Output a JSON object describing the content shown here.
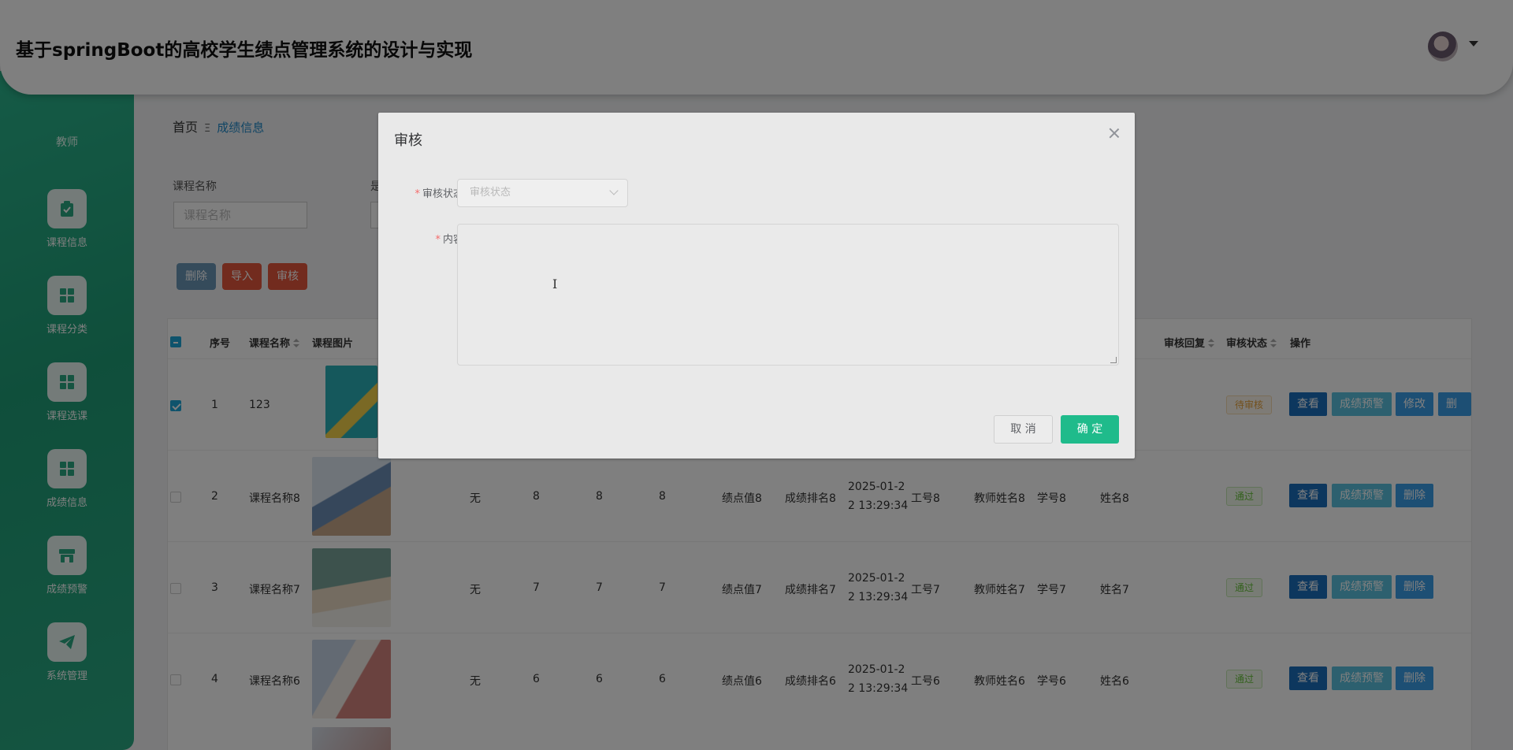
{
  "header": {
    "title": "基于springBoot的高校学生绩点管理系统的设计与实现"
  },
  "sidebar": {
    "role": "教师",
    "items": [
      {
        "label": "课程信息",
        "icon": "clipboard-check-icon"
      },
      {
        "label": "课程分类",
        "icon": "grid-icon"
      },
      {
        "label": "课程选课",
        "icon": "grid-icon"
      },
      {
        "label": "成绩信息",
        "icon": "grid-icon"
      },
      {
        "label": "成绩预警",
        "icon": "store-icon"
      },
      {
        "label": "系统管理",
        "icon": "paper-plane-icon"
      }
    ]
  },
  "breadcrumb": {
    "home": "首页",
    "separator": "Ξ",
    "current": "成绩信息"
  },
  "filters": {
    "course_label": "课程名称",
    "course_placeholder": "课程名称",
    "second_label": "是"
  },
  "toolbar": {
    "delete": "删除",
    "import": "导入",
    "audit": "审核"
  },
  "table": {
    "headers": {
      "index": "序号",
      "course_name": "课程名称",
      "course_image": "课程图片",
      "audit_reply": "审核回复",
      "audit_status": "审核状态",
      "actions": "操作"
    },
    "rows": [
      {
        "index": "1",
        "course_name": "123",
        "c1": "",
        "c2": "",
        "c3": "",
        "c4": "",
        "gpa": "",
        "rank": "",
        "time1": "",
        "time2": "",
        "teacher_no": "",
        "teacher_name": "",
        "student_no": "",
        "student_name": "",
        "status": "待审核",
        "checked": true
      },
      {
        "index": "2",
        "course_name": "课程名称8",
        "c1": "无",
        "c2": "8",
        "c3": "8",
        "c4": "8",
        "gpa": "绩点值8",
        "rank": "成绩排名8",
        "time1": "2025-01-2",
        "time2": "2 13:29:34",
        "teacher_no": "工号8",
        "teacher_name": "教师姓名8",
        "student_no": "学号8",
        "student_name": "姓名8",
        "status": "通过",
        "checked": false
      },
      {
        "index": "3",
        "course_name": "课程名称7",
        "c1": "无",
        "c2": "7",
        "c3": "7",
        "c4": "7",
        "gpa": "绩点值7",
        "rank": "成绩排名7",
        "time1": "2025-01-2",
        "time2": "2 13:29:34",
        "teacher_no": "工号7",
        "teacher_name": "教师姓名7",
        "student_no": "学号7",
        "student_name": "姓名7",
        "status": "通过",
        "checked": false
      },
      {
        "index": "4",
        "course_name": "课程名称6",
        "c1": "无",
        "c2": "6",
        "c3": "6",
        "c4": "6",
        "gpa": "绩点值6",
        "rank": "成绩排名6",
        "time1": "2025-01-2",
        "time2": "2 13:29:34",
        "teacher_no": "工号6",
        "teacher_name": "教师姓名6",
        "student_no": "学号6",
        "student_name": "姓名6",
        "status": "通过",
        "checked": false
      }
    ],
    "actions": {
      "view": "查看",
      "warning": "成绩预警",
      "edit": "修改",
      "delete": "删除"
    }
  },
  "dialog": {
    "title": "审核",
    "status_label": "审核状态",
    "status_placeholder": "审核状态",
    "content_label": "内容",
    "content_value": "",
    "cancel": "取 消",
    "confirm": "确 定"
  },
  "colors": {
    "accent": "#1fbb8b",
    "sidebar": "#23a67f",
    "danger": "#e4573d",
    "primary": "#1a6fbd"
  }
}
